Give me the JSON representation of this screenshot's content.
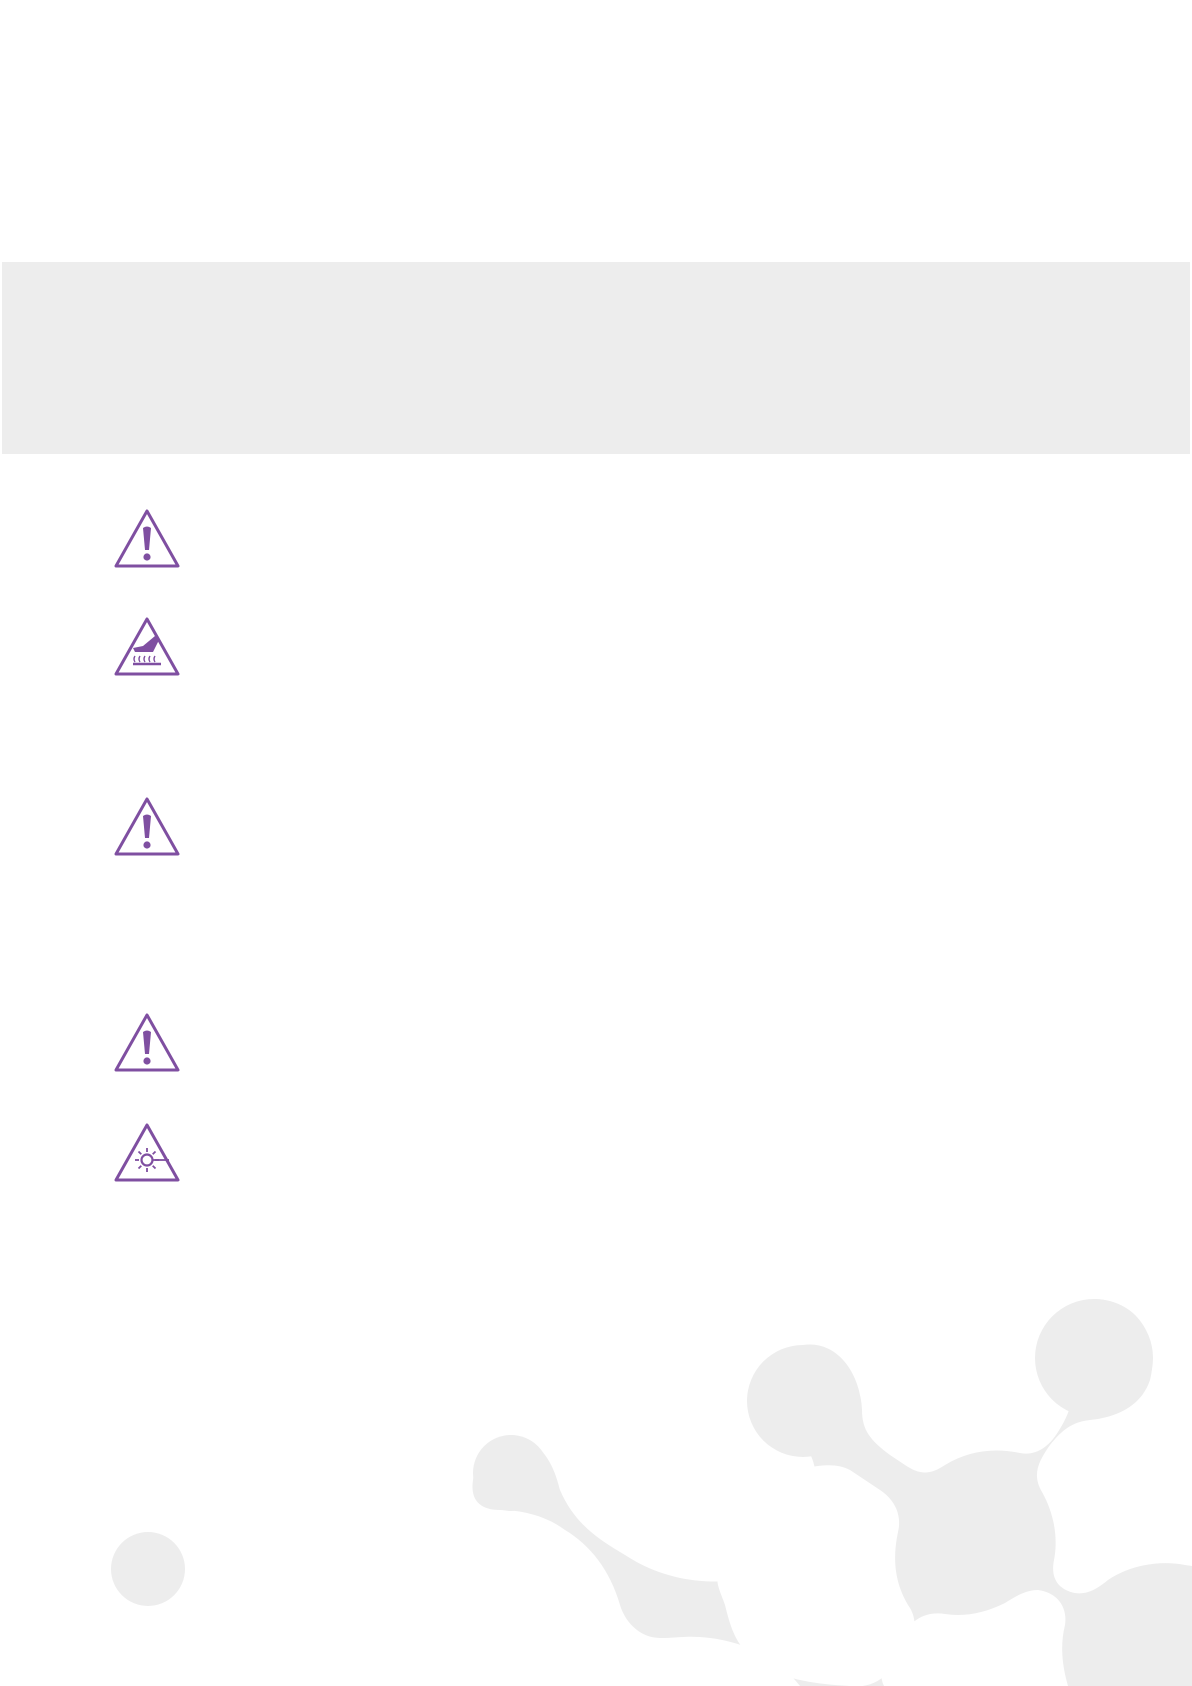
{
  "document": {
    "colors": {
      "accent": "#7f4fa1",
      "band": "#ededed",
      "decoration": "#ededed"
    },
    "warning_signs": [
      {
        "icon": "exclamation-warning-icon"
      },
      {
        "icon": "hot-surface-warning-icon"
      },
      {
        "icon": "exclamation-warning-icon"
      },
      {
        "icon": "exclamation-warning-icon"
      },
      {
        "icon": "laser-radiation-warning-icon"
      }
    ]
  }
}
